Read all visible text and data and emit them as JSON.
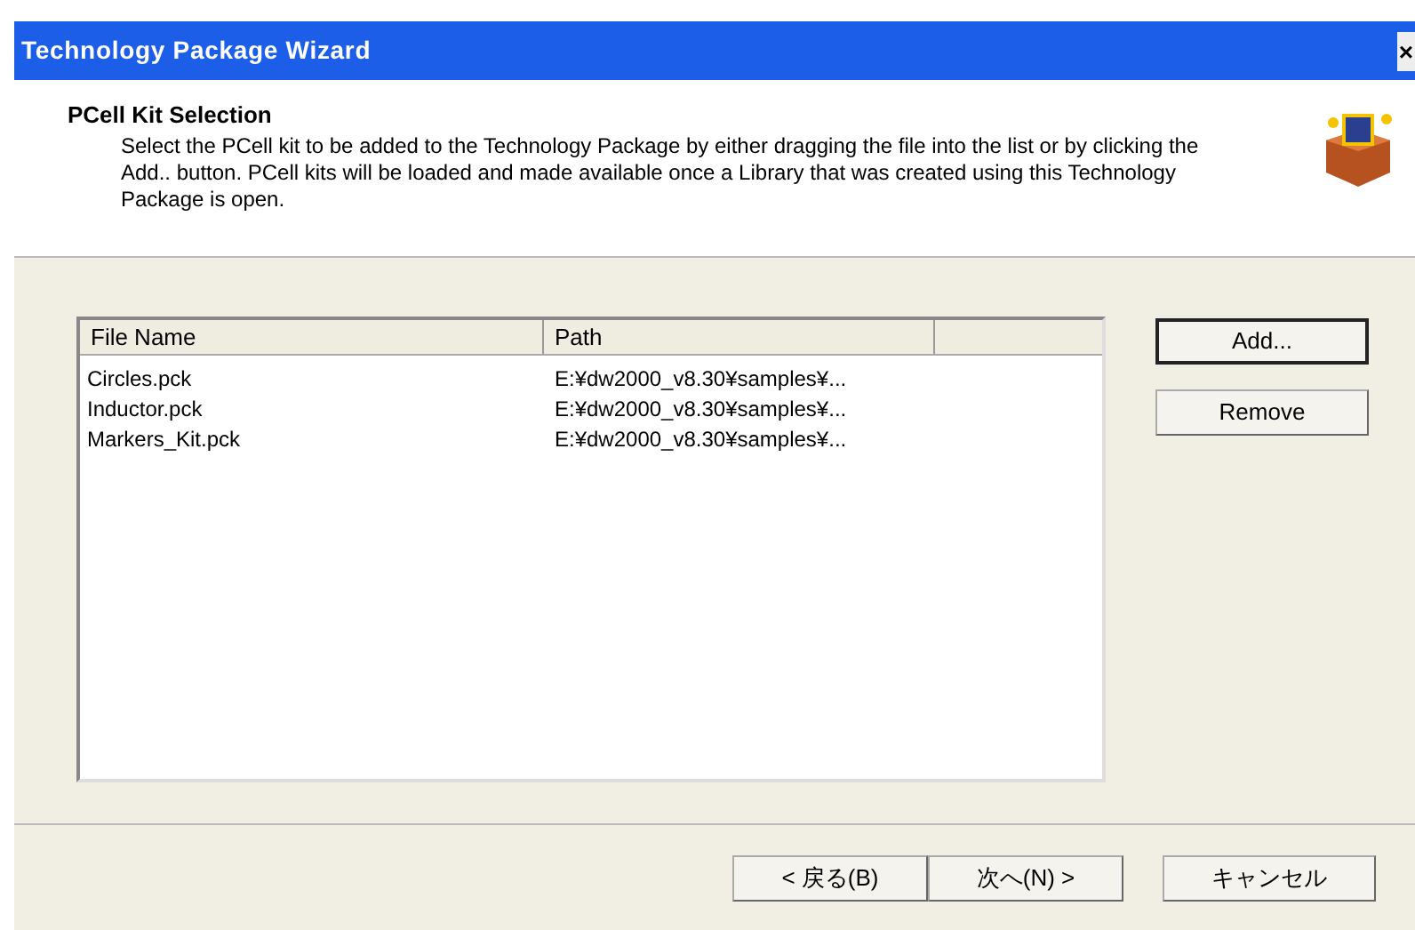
{
  "window": {
    "title": "Technology Package Wizard",
    "close": "×"
  },
  "header": {
    "title": "PCell Kit Selection",
    "description": "Select the PCell kit to be added to the Technology Package by either dragging the file into the list or by clicking the Add.. button. PCell kits will be loaded and made available once a Library that was created using this Technology Package is open."
  },
  "table": {
    "columns": [
      "File Name",
      "Path"
    ],
    "rows": [
      [
        "Circles.pck",
        "E:¥dw2000_v8.30¥samples¥..."
      ],
      [
        "Inductor.pck",
        "E:¥dw2000_v8.30¥samples¥..."
      ],
      [
        "Markers_Kit.pck",
        "E:¥dw2000_v8.30¥samples¥..."
      ]
    ]
  },
  "side_buttons": [
    {
      "label": "Add...",
      "default": true
    },
    {
      "label": "Remove",
      "default": false
    }
  ],
  "footer_buttons": [
    "< 戻る(B)",
    "次へ(N) >",
    "キャンセル"
  ]
}
